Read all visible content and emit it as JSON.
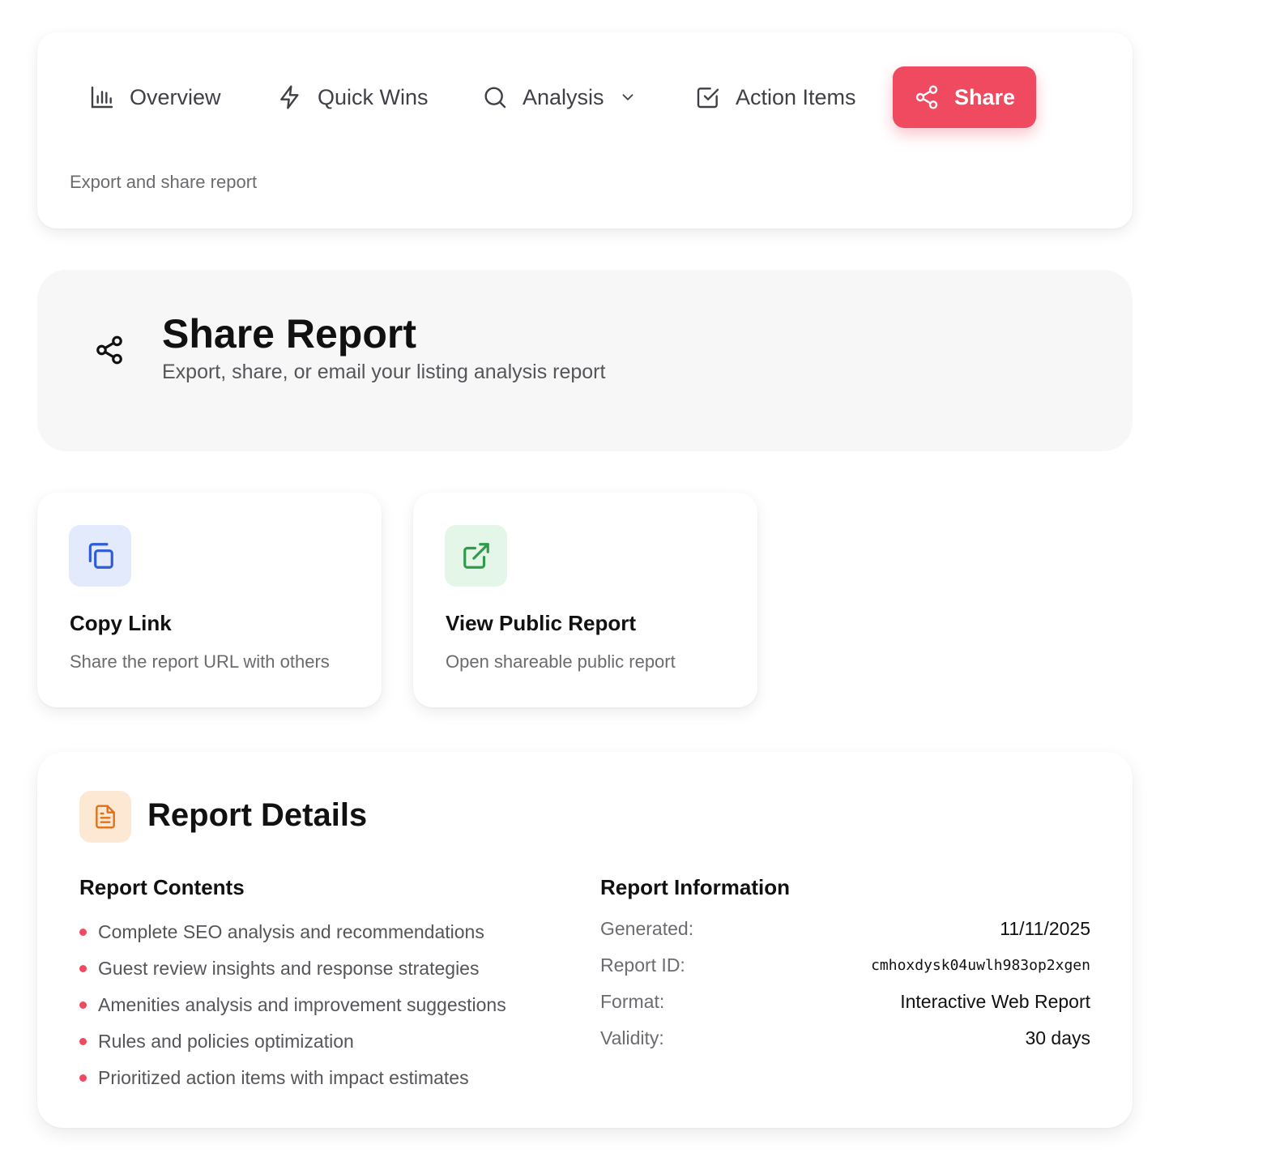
{
  "nav": {
    "items": [
      {
        "label": "Overview",
        "icon": "bar-chart-icon"
      },
      {
        "label": "Quick Wins",
        "icon": "lightning-icon"
      },
      {
        "label": "Analysis",
        "icon": "search-icon"
      },
      {
        "label": "Action Items",
        "icon": "checkbox-icon"
      },
      {
        "label": "Share",
        "icon": "share-icon"
      }
    ],
    "active_item": "Share",
    "subtitle": "Export and share report"
  },
  "header": {
    "title": "Share Report",
    "subtitle": "Export, share, or email your listing analysis report"
  },
  "actions": [
    {
      "title": "Copy Link",
      "description": "Share the report URL with others",
      "icon": "copy-icon",
      "color": "#2f5bd8",
      "bg": "#e2eafc"
    },
    {
      "title": "View Public Report",
      "description": "Open shareable public report",
      "icon": "external-link-icon",
      "color": "#2f9c4a",
      "bg": "#e3f6e7"
    }
  ],
  "details": {
    "title": "Report Details",
    "contents": {
      "heading": "Report Contents",
      "items": [
        "Complete SEO analysis and recommendations",
        "Guest review insights and response strategies",
        "Amenities analysis and improvement suggestions",
        "Rules and policies optimization",
        "Prioritized action items with impact estimates"
      ]
    },
    "information": {
      "heading": "Report Information",
      "rows": [
        {
          "label": "Generated:",
          "value": "11/11/2025"
        },
        {
          "label": "Report ID:",
          "value": "cmhoxdysk04uwlh983op2xgen"
        },
        {
          "label": "Format:",
          "value": "Interactive Web Report"
        },
        {
          "label": "Validity:",
          "value": "30 days"
        }
      ]
    }
  },
  "colors": {
    "accent": "#ef4a5f",
    "details_icon": "#e0701c",
    "details_icon_bg": "#fde9d3"
  }
}
